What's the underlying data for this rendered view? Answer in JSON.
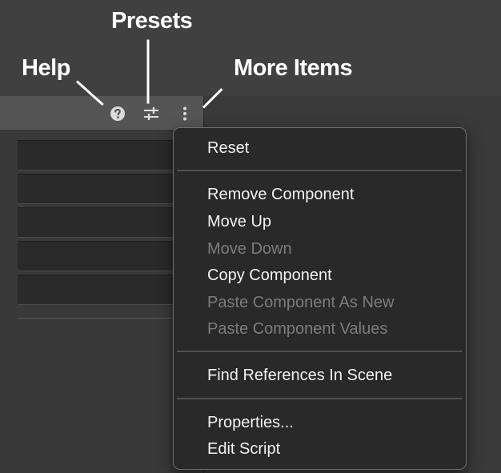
{
  "callouts": {
    "help": "Help",
    "presets": "Presets",
    "more_items": "More Items"
  },
  "header_icons": [
    {
      "name": "help-icon"
    },
    {
      "name": "presets-icon"
    },
    {
      "name": "more-items-icon"
    }
  ],
  "context_menu": {
    "groups": [
      [
        {
          "label": "Reset",
          "enabled": true
        }
      ],
      [
        {
          "label": "Remove Component",
          "enabled": true
        },
        {
          "label": "Move Up",
          "enabled": true
        },
        {
          "label": "Move Down",
          "enabled": false
        },
        {
          "label": "Copy Component",
          "enabled": true
        },
        {
          "label": "Paste Component As New",
          "enabled": false
        },
        {
          "label": "Paste Component Values",
          "enabled": false
        }
      ],
      [
        {
          "label": "Find References In Scene",
          "enabled": true
        }
      ],
      [
        {
          "label": "Properties...",
          "enabled": true
        },
        {
          "label": "Edit Script",
          "enabled": true
        }
      ]
    ]
  },
  "colors": {
    "background": "#404040",
    "header": "#555555",
    "menu_bg": "#292929",
    "enabled_text": "#f2f2f2",
    "disabled_text": "#7c7c7c"
  }
}
